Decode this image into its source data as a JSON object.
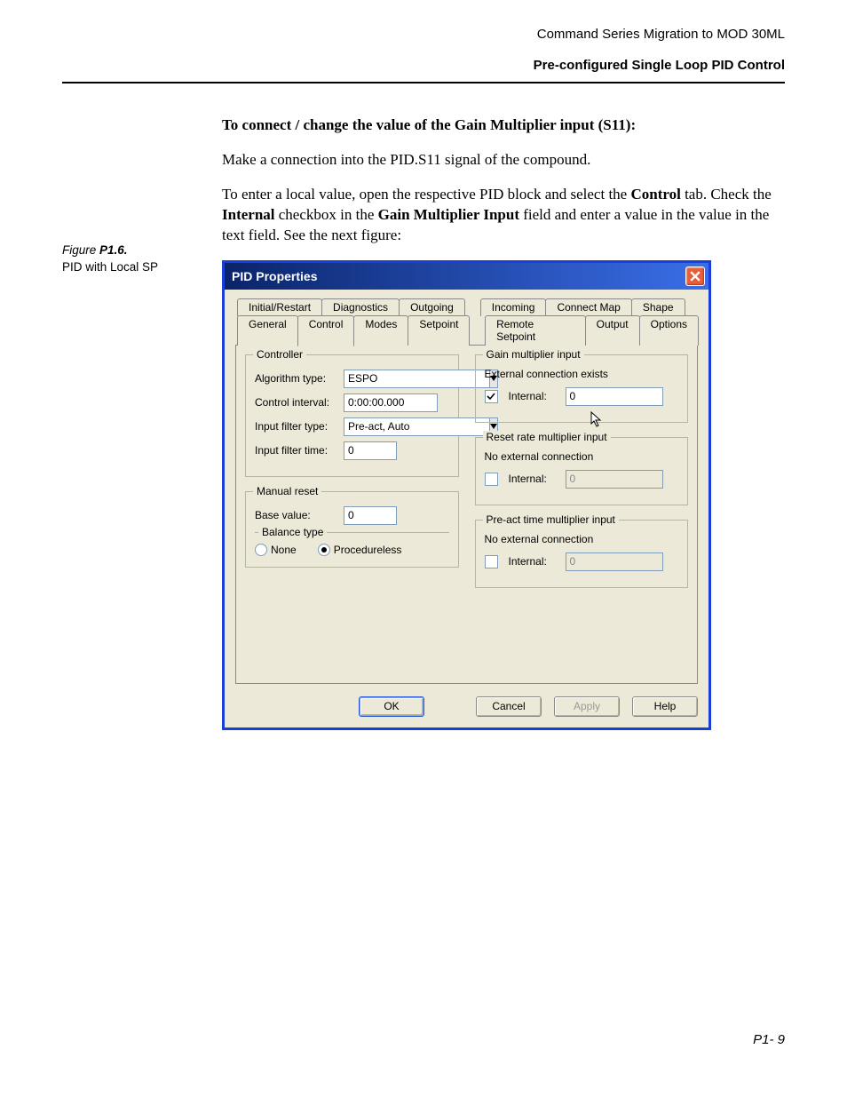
{
  "header": {
    "line1": "Command Series Migration to MOD 30ML",
    "line2": "Pre-configured Single Loop PID Control"
  },
  "figure": {
    "label_prefix": "Figure ",
    "label_num": "P1.6.",
    "caption": "PID with Local SP"
  },
  "paras": {
    "p1": "To connect / change the value of the Gain Multiplier input (S11):",
    "p2": "Make a connection into the PID.S11 signal of the compound.",
    "p3a": "To enter a local value, open the respective PID block and select the ",
    "p3b": "Control",
    "p3c": " tab. Check the ",
    "p3d": "Internal",
    "p3e": " checkbox in the ",
    "p3f": "Gain Multiplier Input",
    "p3g": " field and enter a value in the value in the text field. See the next figure:"
  },
  "dialog": {
    "title": "PID Properties",
    "tabs_row1": [
      "Initial/Restart",
      "Diagnostics",
      "Outgoing"
    ],
    "tabs_row1b": [
      "Incoming",
      "Connect Map",
      "Shape"
    ],
    "tabs_row2": [
      "General",
      "Control",
      "Modes",
      "Setpoint"
    ],
    "tabs_row2b": [
      "Remote Setpoint",
      "Output",
      "Options"
    ],
    "active_tab": "Control",
    "groups": {
      "controller": {
        "legend": "Controller",
        "algo_label": "Algorithm type:",
        "algo_value": "ESPO",
        "interval_label": "Control interval:",
        "interval_value": "0:00:00.000",
        "filter_type_label": "Input filter type:",
        "filter_type_value": "Pre-act, Auto",
        "filter_time_label": "Input filter time:",
        "filter_time_value": "0"
      },
      "manual_reset": {
        "legend": "Manual reset",
        "base_label": "Base value:",
        "base_value": "0",
        "balance_legend": "Balance type",
        "opt_none": "None",
        "opt_proc": "Procedureless"
      },
      "gain": {
        "legend": "Gain multiplier input",
        "status": "External connection exists",
        "internal_label": "Internal:",
        "internal_checked": true,
        "internal_value": "0"
      },
      "reset": {
        "legend": "Reset rate multiplier input",
        "status": "No external connection",
        "internal_label": "Internal:",
        "internal_checked": false,
        "internal_value": "0"
      },
      "preact": {
        "legend": "Pre-act time multiplier input",
        "status": "No external connection",
        "internal_label": "Internal:",
        "internal_checked": false,
        "internal_value": "0"
      }
    },
    "buttons": {
      "ok": "OK",
      "cancel": "Cancel",
      "apply": "Apply",
      "help": "Help"
    }
  },
  "footer": "P1- 9"
}
